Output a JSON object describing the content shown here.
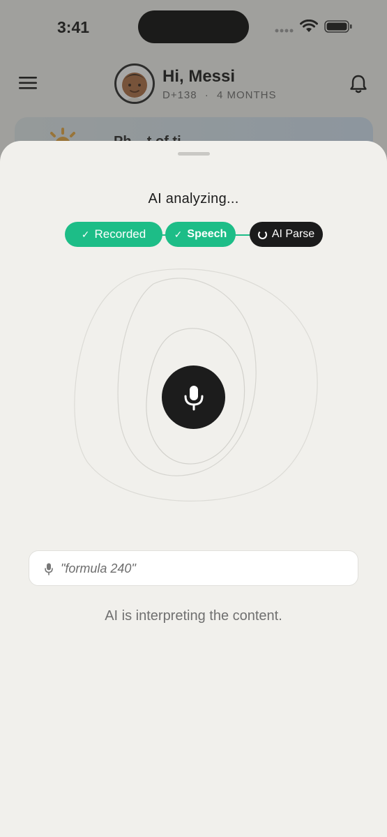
{
  "status_bar": {
    "time": "3:41"
  },
  "header": {
    "greeting": "Hi, Messi",
    "days": "D+138",
    "separator": "·",
    "age": "4 MONTHS"
  },
  "banner": {
    "text": "Ph... t of ti..."
  },
  "sheet": {
    "title": "AI analyzing...",
    "steps": [
      {
        "label": "Recorded",
        "state": "done"
      },
      {
        "label": "Speech",
        "state": "done"
      },
      {
        "label": "AI Parse",
        "state": "active"
      }
    ],
    "transcript": "\"formula 240\"",
    "status": "AI is interpreting the content."
  },
  "colors": {
    "done": "#1dbd87",
    "active": "#1b1b1b",
    "sheet_bg": "#f1f0ec"
  },
  "icons": [
    "menu-icon",
    "bell-icon",
    "mic-icon",
    "check-icon",
    "spinner-icon",
    "wifi-icon",
    "battery-icon",
    "signal-icon"
  ]
}
